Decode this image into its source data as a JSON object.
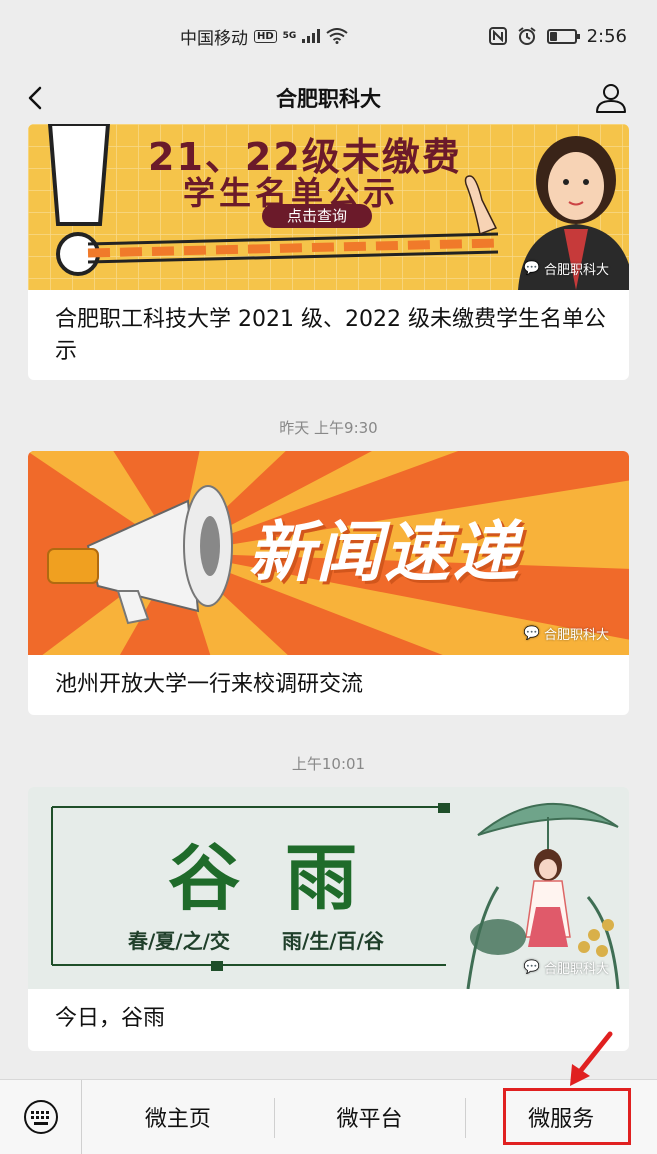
{
  "status_bar": {
    "carrier": "中国移动",
    "hd": "HD",
    "network": "5G",
    "time": "2:56",
    "battery_level": 0.3
  },
  "nav": {
    "title": "合肥职科大",
    "back_icon": "chevron-left-icon",
    "profile_icon": "person-icon"
  },
  "feed": {
    "articles": [
      {
        "banner_line1": "21、22级未缴费",
        "banner_line2": "学生名单公示",
        "banner_button": "点击查询",
        "watermark": "合肥职科大",
        "title": "合肥职工科技大学 2021 级、2022 级未缴费学生名单公示"
      },
      {
        "timestamp": "昨天 上午9:30",
        "banner_text": "新闻速递",
        "watermark": "合肥职科大",
        "title": "池州开放大学一行来校调研交流"
      },
      {
        "timestamp": "上午10:01",
        "banner_main": "谷 雨",
        "banner_sub_left": "春/夏/之/交",
        "banner_sub_right": "雨/生/百/谷",
        "watermark": "合肥职科大",
        "title": "今日，谷雨"
      }
    ]
  },
  "bottom_menu": {
    "keyboard_icon": "keyboard-icon",
    "items": [
      "微主页",
      "微平台",
      "微服务"
    ],
    "highlight_color": "#e02020"
  },
  "colors": {
    "background": "#ededed",
    "banner1_bg": "#f5c44a",
    "banner2_bg": "#f06a2a",
    "banner3_bg": "#e6ece9",
    "green_text": "#1f6b2a"
  }
}
